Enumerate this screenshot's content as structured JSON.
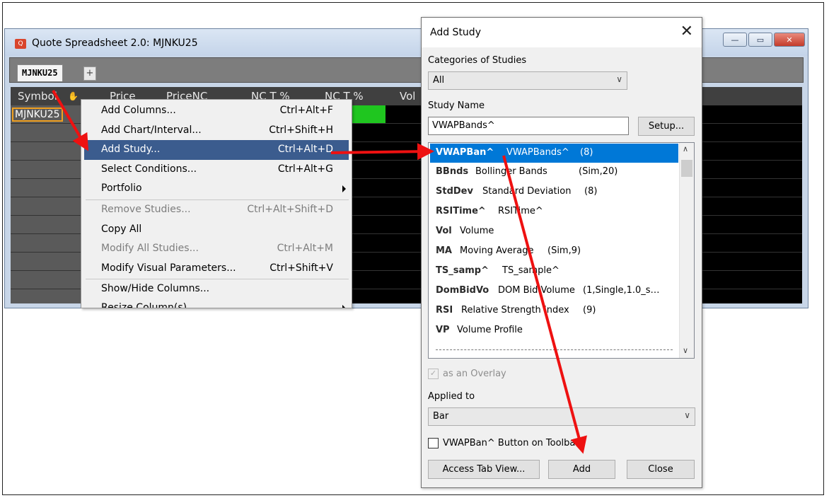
{
  "quote_window": {
    "title": "Quote Spreadsheet 2.0: MJNKU25",
    "app_icon_text": "Q",
    "tab_label": "MJNKU25",
    "add_tab_label": "+",
    "columns": [
      "Symbol",
      "Price",
      "PriceNC",
      "NC T %",
      "NC T %",
      "Vol"
    ],
    "symbol_value": "MJNKU25",
    "window_buttons": {
      "minimize": "—",
      "maximize": "▭",
      "close": "✕"
    }
  },
  "context_menu": {
    "items": [
      {
        "label": "Add Columns...",
        "shortcut": "Ctrl+Alt+F"
      },
      {
        "label": "Add Chart/Interval...",
        "shortcut": "Ctrl+Shift+H"
      },
      {
        "label": "Add Study...",
        "shortcut": "Ctrl+Alt+D"
      },
      {
        "label": "Select Conditions...",
        "shortcut": "Ctrl+Alt+G"
      },
      {
        "label": "Portfolio",
        "shortcut": ""
      },
      {
        "label": "Remove Studies...",
        "shortcut": "Ctrl+Alt+Shift+D"
      },
      {
        "label": "Copy All",
        "shortcut": ""
      },
      {
        "label": "Modify All Studies...",
        "shortcut": "Ctrl+Alt+M"
      },
      {
        "label": "Modify Visual Parameters...",
        "shortcut": "Ctrl+Shift+V"
      },
      {
        "label": "Show/Hide Columns...",
        "shortcut": ""
      },
      {
        "label": "Resize Column(s)",
        "shortcut": ""
      }
    ]
  },
  "dialog": {
    "title": "Add Study",
    "close_glyph": "✕",
    "categories_label": "Categories of Studies",
    "category_value": "All",
    "study_name_label": "Study Name",
    "study_name_value": "VWAPBands^",
    "setup_button": "Setup...",
    "studies": [
      {
        "abbr": "VWAPBan^",
        "name": "VWAPBands^",
        "params": "(8)"
      },
      {
        "abbr": "BBnds",
        "name": "Bollinger Bands",
        "params": "(Sim,20)"
      },
      {
        "abbr": "StdDev",
        "name": "Standard Deviation",
        "params": "(8)"
      },
      {
        "abbr": "RSITime^",
        "name": "RSITime^",
        "params": ""
      },
      {
        "abbr": "Vol",
        "name": "Volume",
        "params": ""
      },
      {
        "abbr": "MA",
        "name": "Moving Average",
        "params": "(Sim,9)"
      },
      {
        "abbr": "TS_samp^",
        "name": "TS_sample^",
        "params": ""
      },
      {
        "abbr": "DomBidVo",
        "name": "DOM Bid Volume",
        "params": "(1,Single,1.0_s…"
      },
      {
        "abbr": "RSI",
        "name": "Relative Strength Index",
        "params": "(9)"
      },
      {
        "abbr": "VP",
        "name": "Volume Profile",
        "params": ""
      }
    ],
    "overlay_label": "as an Overlay",
    "applied_to_label": "Applied to",
    "applied_to_value": "Bar",
    "toolbar_checkbox_label": "VWAPBan^ Button on Toolbar",
    "access_tab_button": "Access Tab View...",
    "add_button": "Add",
    "close_button": "Close"
  },
  "colors": {
    "annotation_arrow": "#ee1111",
    "menu_highlight": "#3b5c8e",
    "list_selection": "#0078d7",
    "green_cell": "#1fc61f"
  }
}
